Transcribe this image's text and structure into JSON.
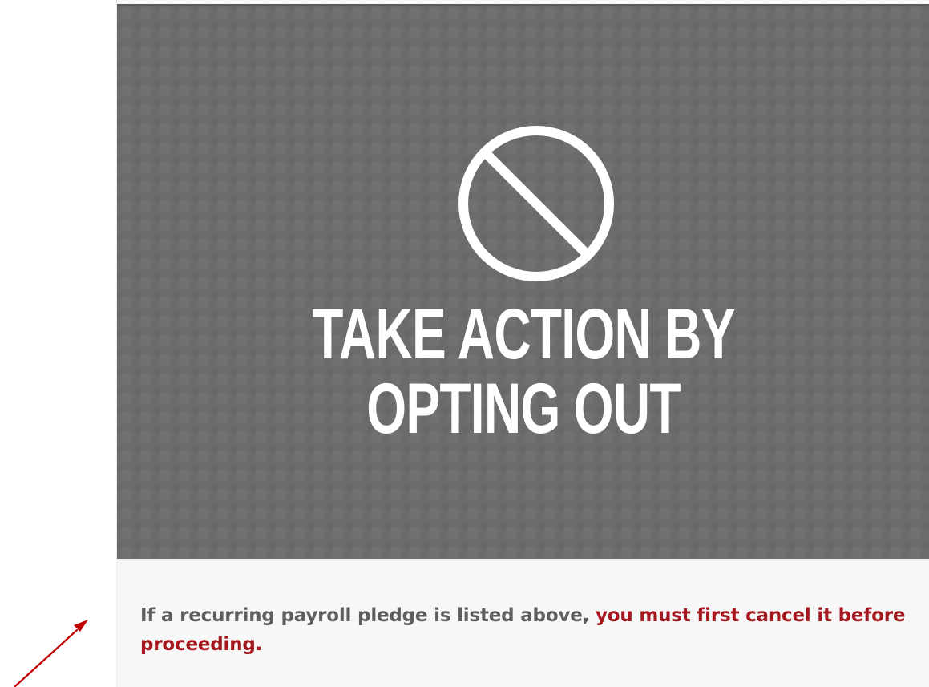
{
  "hero": {
    "title_line1": "TAKE ACTION BY",
    "title_line2": "OPTING OUT",
    "icon": "prohibited-icon",
    "background_color": "#6c6b6b"
  },
  "notice": {
    "lead_text": "If a recurring payroll pledge is listed above, ",
    "warning_text": "you must first cancel it before proceeding.",
    "text_color": "#5e5e5e",
    "warning_color": "#a5171f"
  },
  "annotation": {
    "icon": "arrow-icon",
    "color": "#c00000"
  }
}
